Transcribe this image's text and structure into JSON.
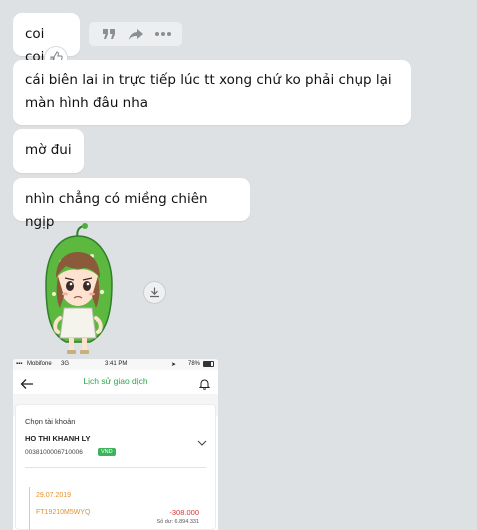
{
  "messages": [
    {
      "text": "coi coi"
    },
    {
      "text": "cái biên lai in trực tiếp lúc tt xong chứ ko phải chụp lại màn hình đâu nha"
    },
    {
      "text": "mờ đui"
    },
    {
      "text": "nhìn chẳng có miềng chiên ngịp"
    }
  ],
  "message_actions": {
    "quote_icon": "quote-icon",
    "forward_icon": "forward-icon",
    "more_icon": "more-icon",
    "reaction_icon": "thumbs-up-icon"
  },
  "sticker": {
    "icon": "green-hooded-girl-sticker"
  },
  "download": {
    "icon": "download-icon"
  },
  "phone_screenshot": {
    "status": {
      "carrier": "Mobifone",
      "network": "3G",
      "time": "3:41 PM",
      "battery": "78%"
    },
    "title": "Lịch sử giao dịch",
    "choose_account": "Chọn tài khoản",
    "account_owner": "HO THI KHANH LY",
    "account_number": "0038100006710006",
    "currency": "VND",
    "transaction": {
      "date": "29.07.2019",
      "ref": "FT19210M5WYQ",
      "amount": "-308.000",
      "balance": "Số dư: 6.894.331"
    },
    "colors": {
      "accent": "#2ea84a",
      "date": "#e0922f",
      "debit": "#d93535"
    }
  }
}
